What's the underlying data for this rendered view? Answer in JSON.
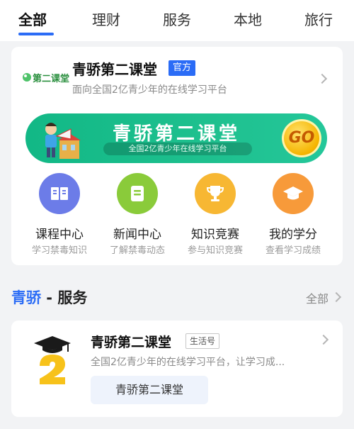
{
  "tabs": [
    {
      "label": "全部",
      "active": true
    },
    {
      "label": "理财"
    },
    {
      "label": "服务"
    },
    {
      "label": "本地"
    },
    {
      "label": "旅行"
    }
  ],
  "card": {
    "logo_text": "第二课堂",
    "title": "青骄第二课堂",
    "official_badge": "官方",
    "subtitle": "面向全国2亿青少年的在线学习平台",
    "banner": {
      "title": "青骄第二课堂",
      "subtitle": "全国2亿青少年在线学习平台",
      "go": "GO"
    },
    "features": [
      {
        "label": "课程中心",
        "sub": "学习禁毒知识",
        "color": "#6c7ce8",
        "icon": "book-icon"
      },
      {
        "label": "新闻中心",
        "sub": "了解禁毒动态",
        "color": "#8acb3a",
        "icon": "news-icon"
      },
      {
        "label": "知识竞赛",
        "sub": "参与知识竞赛",
        "color": "#f7b733",
        "icon": "trophy-icon"
      },
      {
        "label": "我的学分",
        "sub": "查看学习成绩",
        "color": "#f79a3a",
        "icon": "graduation-cap-icon"
      }
    ]
  },
  "section": {
    "brand": "青骄",
    "separator": " - ",
    "title": "服务",
    "all_label": "全部"
  },
  "service": {
    "title": "青骄第二课堂",
    "badge": "生活号",
    "desc": "全国2亿青少年的在线学习平台，让学习成...",
    "chip": "青骄第二课堂"
  }
}
